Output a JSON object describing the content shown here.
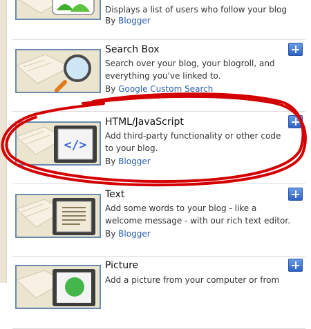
{
  "widgets": [
    {
      "title": "",
      "description": "Displays a list of users who follow your blog",
      "by_prefix": "By",
      "author": "Blogger",
      "thumb_icon": "followers-people-icon"
    },
    {
      "title": "Search Box",
      "description": "Search over your blog, your blogroll, and everything you've linked to.",
      "by_prefix": "By",
      "author": "Google Custom Search",
      "thumb_icon": "magnifying-glass-icon"
    },
    {
      "title": "HTML/JavaScript",
      "description": "Add third-party functionality or other code to your blog.",
      "by_prefix": "By",
      "author": "Blogger",
      "thumb_icon": "code-brackets-icon"
    },
    {
      "title": "Text",
      "description": "Add some words to your blog - like a welcome message - with our rich text editor.",
      "by_prefix": "By",
      "author": "Blogger",
      "thumb_icon": "text-document-icon"
    },
    {
      "title": "Picture",
      "description": "Add a picture from your computer or from",
      "by_prefix": "",
      "author": "",
      "thumb_icon": "picture-icon"
    }
  ],
  "colors": {
    "link": "#2a5db0",
    "add_button": "#3a6fd0",
    "annotation": "#d40000",
    "thumb_border": "#6a8bb0"
  }
}
